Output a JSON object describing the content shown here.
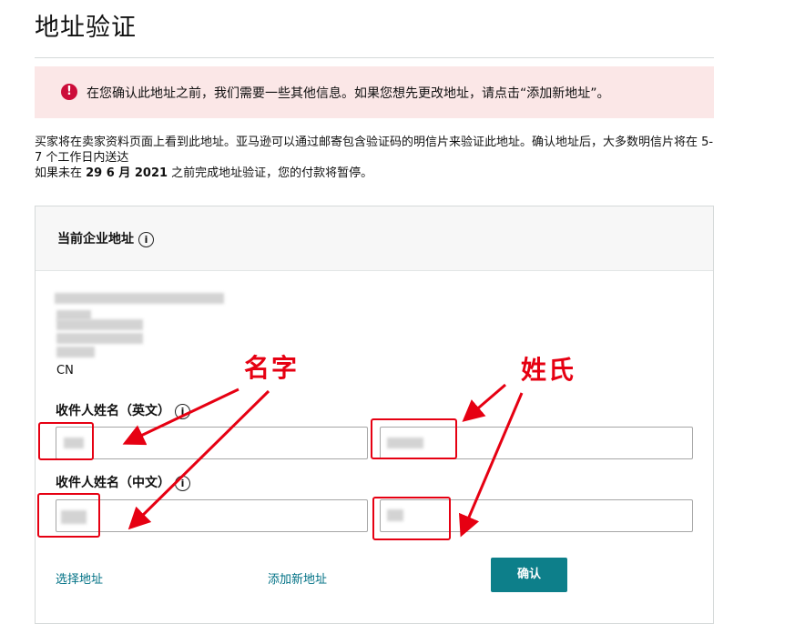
{
  "page": {
    "title": "地址验证"
  },
  "alert": {
    "icon": "exclamation-circle-icon",
    "text": "在您确认此地址之前，我们需要一些其他信息。如果您想先更改地址，请点击“添加新地址”。"
  },
  "info": {
    "line1": "买家将在卖家资料页面上看到此地址。亚马逊可以通过邮寄包含验证码的明信片来验证此地址。确认地址后，大多数明信片将在 5-7 个工作日内送达",
    "line2_prefix": "如果未在 ",
    "deadline": "29 6 月 2021",
    "line2_suffix": " 之前完成地址验证，您的付款将暂停。"
  },
  "card": {
    "title": "当前企业地址",
    "country": "CN",
    "english_name_label": "收件人姓名（英文）",
    "chinese_name_label": "收件人姓名（中文）",
    "info_icon_glyph": "i"
  },
  "actions": {
    "select_address": "选择地址",
    "add_new_address": "添加新地址",
    "confirm": "确认"
  },
  "annotations": {
    "first_name": "名字",
    "last_name": "姓氏",
    "color": "#e60012"
  },
  "colors": {
    "alert_bg": "#fbe7e7",
    "alert_icon": "#cc0c39",
    "link": "#007185",
    "button": "#0d7f8a"
  }
}
